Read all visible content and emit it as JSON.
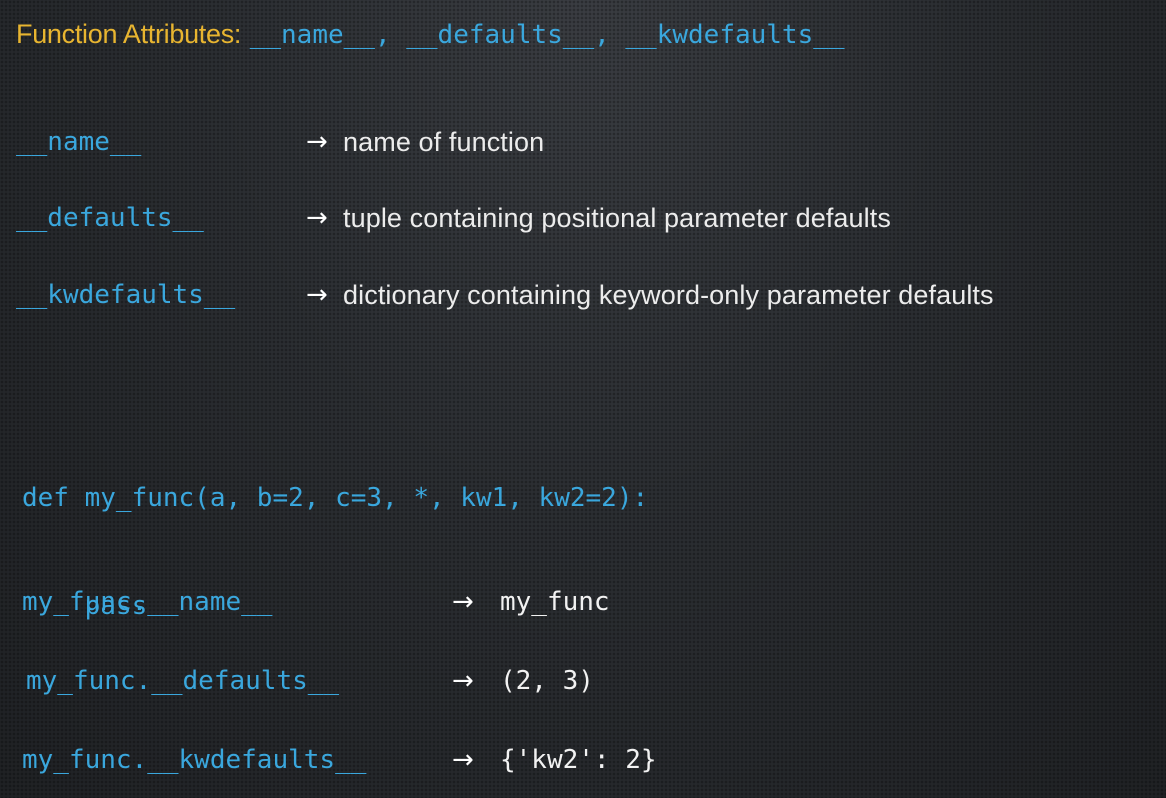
{
  "title": {
    "prefix": "Function Attributes:",
    "code": "__name__, __defaults__, __kwdefaults__"
  },
  "attributes": [
    {
      "name": "__name__",
      "arrow": "→",
      "description": "name of function"
    },
    {
      "name": "__defaults__",
      "arrow": "→",
      "description": "tuple containing positional parameter defaults"
    },
    {
      "name": "__kwdefaults__",
      "arrow": "→",
      "description": "dictionary containing keyword-only parameter defaults"
    }
  ],
  "code": {
    "line1": "def my_func(a, b=2, c=3, *, kw1, kw2=2):",
    "line2": "    pass"
  },
  "results": [
    {
      "expr": "my_func.__name__",
      "arrow": "→",
      "value": "my_func"
    },
    {
      "expr": "my_func.__defaults__",
      "arrow": "→",
      "value": "(2, 3)"
    },
    {
      "expr": "my_func.__kwdefaults__",
      "arrow": "→",
      "value": "{'kw2': 2}"
    }
  ],
  "colors": {
    "title": "#e8b530",
    "code": "#3aa7dd",
    "text": "#ececec",
    "background": "#2a2d31"
  }
}
